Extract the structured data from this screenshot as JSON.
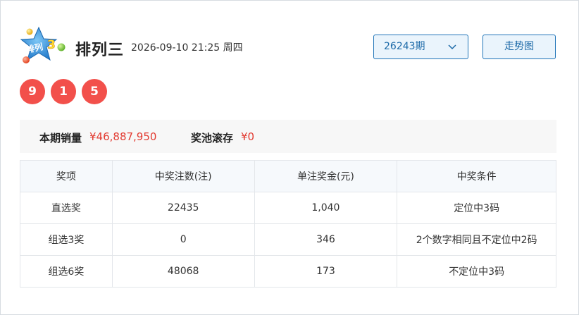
{
  "header": {
    "logo_text": "排列3",
    "title": "排列三",
    "datetime": "2026-09-10 21:25 周四",
    "period_select": "26243期",
    "trend_button": "走势图"
  },
  "result_balls": [
    "9",
    "1",
    "5"
  ],
  "stats": {
    "sales_label": "本期销量",
    "sales_value": "¥46,887,950",
    "pool_label": "奖池滚存",
    "pool_value": "¥0"
  },
  "table": {
    "headers": [
      "奖项",
      "中奖注数(注)",
      "单注奖金(元)",
      "中奖条件"
    ],
    "rows": [
      [
        "直选奖",
        "22435",
        "1,040",
        "定位中3码"
      ],
      [
        "组选3奖",
        "0",
        "346",
        "2个数字相同且不定位中2码"
      ],
      [
        "组选6奖",
        "48068",
        "173",
        "不定位中3码"
      ]
    ]
  },
  "colors": {
    "ball_red": "#f2504b",
    "accent_blue": "#1f74b8",
    "value_red": "#e23a30"
  }
}
